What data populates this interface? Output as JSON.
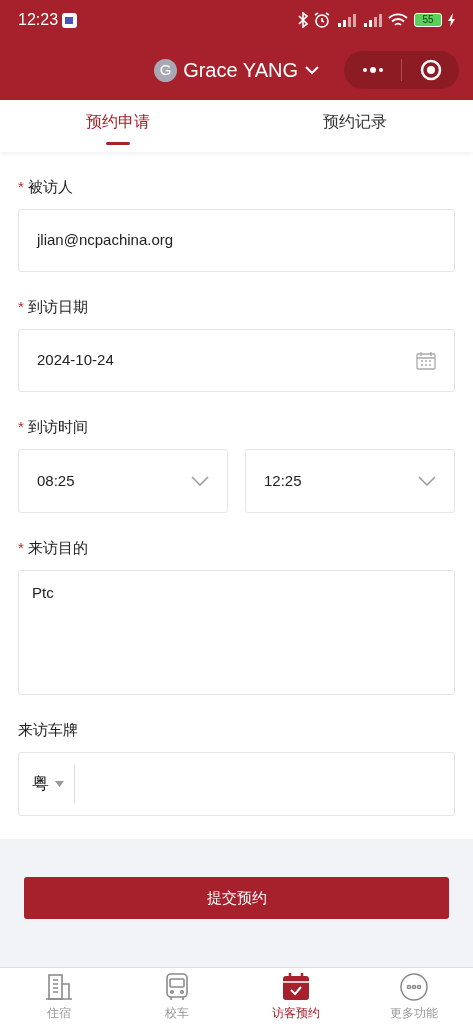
{
  "status_bar": {
    "time": "12:23",
    "battery": "55"
  },
  "header": {
    "avatar": "G",
    "user_name": "Grace YANG"
  },
  "tabs": [
    {
      "label": "预约申请",
      "selected": true
    },
    {
      "label": "预约记录",
      "selected": false
    }
  ],
  "form": [
    {
      "kind": "text",
      "label": "被访人",
      "required_mark": "*",
      "value": "jlian@ncpachina.org"
    },
    {
      "kind": "date",
      "label": "到访日期",
      "required_mark": "*",
      "value": "2024-10-24"
    },
    {
      "kind": "time_range",
      "label": "到访时间",
      "required_mark": "*",
      "values": [
        "08:25",
        "12:25"
      ]
    },
    {
      "kind": "textarea",
      "label": "来访目的",
      "required_mark": "*",
      "value": "Ptc"
    },
    {
      "kind": "plate",
      "label": "来访车牌",
      "province": "粤"
    }
  ],
  "submit_button": "提交预约",
  "bottom_nav": [
    {
      "label": "住宿",
      "kind": "building",
      "selected": false
    },
    {
      "label": "校车",
      "kind": "bus",
      "selected": false
    },
    {
      "label": "访客预约",
      "kind": "calendar",
      "selected": true
    },
    {
      "label": "更多功能",
      "kind": "more",
      "selected": false
    }
  ]
}
